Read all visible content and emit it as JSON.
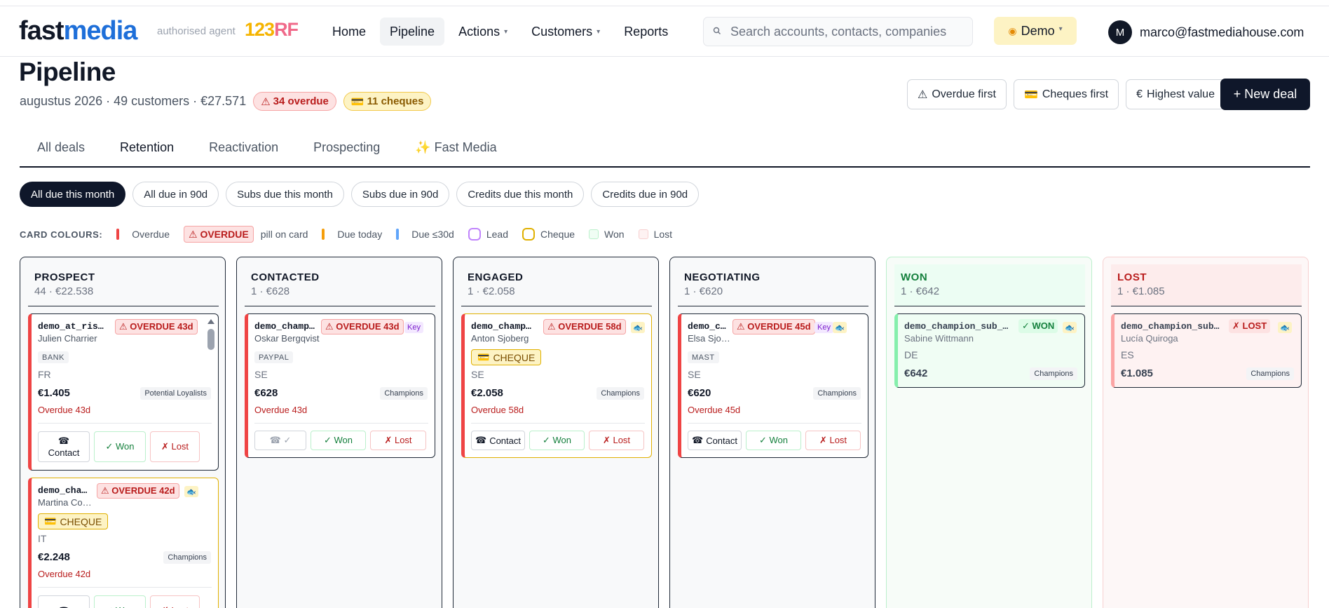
{
  "nav": {
    "logo_fast": "fast",
    "logo_media": "media",
    "authorised": "authorised agent",
    "partner_a": "123",
    "partner_b": "RF",
    "links": {
      "home": "Home",
      "pipeline": "Pipeline",
      "actions": "Actions",
      "customers": "Customers",
      "reports": "Reports"
    },
    "search_placeholder": "Search accounts, contacts, companies",
    "demo": "Demo",
    "avatar": "M",
    "email": "marco@fastmediahouse.com"
  },
  "header": {
    "title": "Pipeline",
    "subtitle": "augustus 2026 · 49 customers · €27.571",
    "overdue_pill": "34 overdue",
    "cheques_pill": "11 cheques",
    "sort_overdue": "Overdue first",
    "sort_cheques": "Cheques first",
    "sort_value": "Highest value",
    "new_deal": "+ New deal"
  },
  "tabs": {
    "all": "All deals",
    "retention": "Retention",
    "reactivation": "Reactivation",
    "prospecting": "Prospecting",
    "fastmedia": "✨ Fast Media"
  },
  "chips": {
    "all_month": "All due this month",
    "all_90": "All due in 90d",
    "subs_month": "Subs due this month",
    "subs_90": "Subs due in 90d",
    "credits_month": "Credits due this month",
    "credits_90": "Credits due in 90d"
  },
  "legend": {
    "title": "CARD COLOURS:",
    "overdue": "Overdue",
    "overdue_pill": "⚠ OVERDUE",
    "pill_on_card": "pill on card",
    "due_today": "Due today",
    "due_30": "Due ≤30d",
    "lead": "Lead",
    "cheque": "Cheque",
    "won": "Won",
    "lost": "Lost",
    "colors": {
      "overdue": "#ef4444",
      "due_today": "#f59e0b",
      "due_30": "#60a5fa",
      "lead": "#c084fc",
      "cheque": "#e0b000",
      "won": "#bbf0cc",
      "lost": "#f7d0d0"
    }
  },
  "columns": {
    "prospect": {
      "name": "PROSPECT",
      "meta": "44 · €22.538",
      "cards": [
        {
          "name": "demo_at_ris…",
          "badge": "⚠ OVERDUE 43d",
          "contact": "Julien Charrier",
          "pay": "BANK",
          "country": "FR",
          "amount": "€1.405",
          "segment": "Potential Loyalists",
          "overdue": "Overdue 43d",
          "contact_btn": "Contact",
          "won_btn": "✓ Won",
          "lost_btn": "✗ Lost"
        },
        {
          "name": "demo_cha…",
          "badge": "⚠ OVERDUE 42d",
          "contact": "Martina Co…",
          "cheque": "CHEQUE",
          "country": "IT",
          "amount": "€2.248",
          "segment": "Champions",
          "overdue": "Overdue 42d",
          "won_btn": "✓ Won",
          "lost_btn": "✗ Lost"
        }
      ]
    },
    "contacted": {
      "name": "CONTACTED",
      "meta": "1 · €628",
      "card": {
        "name": "demo_champ…",
        "badge": "⚠ OVERDUE 43d",
        "key": "Key",
        "contact": "Oskar Bergqvist",
        "pay": "PAYPAL",
        "country": "SE",
        "amount": "€628",
        "segment": "Champions",
        "overdue": "Overdue 43d",
        "contact_btn": "☎ ✓",
        "won_btn": "✓ Won",
        "lost_btn": "✗ Lost"
      }
    },
    "engaged": {
      "name": "ENGAGED",
      "meta": "1 · €2.058",
      "card": {
        "name": "demo_champ…",
        "badge": "⚠ OVERDUE 58d",
        "contact": "Anton Sjoberg",
        "cheque": "CHEQUE",
        "country": "SE",
        "amount": "€2.058",
        "segment": "Champions",
        "overdue": "Overdue 58d",
        "contact_btn": "Contact",
        "won_btn": "✓ Won",
        "lost_btn": "✗ Lost"
      }
    },
    "negotiating": {
      "name": "NEGOTIATING",
      "meta": "1 · €620",
      "card": {
        "name": "demo_c…",
        "badge": "⚠ OVERDUE 45d",
        "key": "Key",
        "contact": "Elsa Sjo…",
        "pay": "MAST",
        "country": "SE",
        "amount": "€620",
        "segment": "Champions",
        "overdue": "Overdue 45d",
        "contact_btn": "Contact",
        "won_btn": "✓ Won",
        "lost_btn": "✗ Lost"
      }
    },
    "won": {
      "name": "WON",
      "meta": "1 · €642",
      "card": {
        "name": "demo_champion_sub_…",
        "badge": "✓ WON",
        "contact": "Sabine Wittmann",
        "country": "DE",
        "amount": "€642",
        "segment": "Champions"
      }
    },
    "lost": {
      "name": "LOST",
      "meta": "1 · €1.085",
      "card": {
        "name": "demo_champion_sub…",
        "badge": "✗ LOST",
        "contact": "Lucía Quiroga",
        "country": "ES",
        "amount": "€1.085",
        "segment": "Champions"
      }
    }
  }
}
